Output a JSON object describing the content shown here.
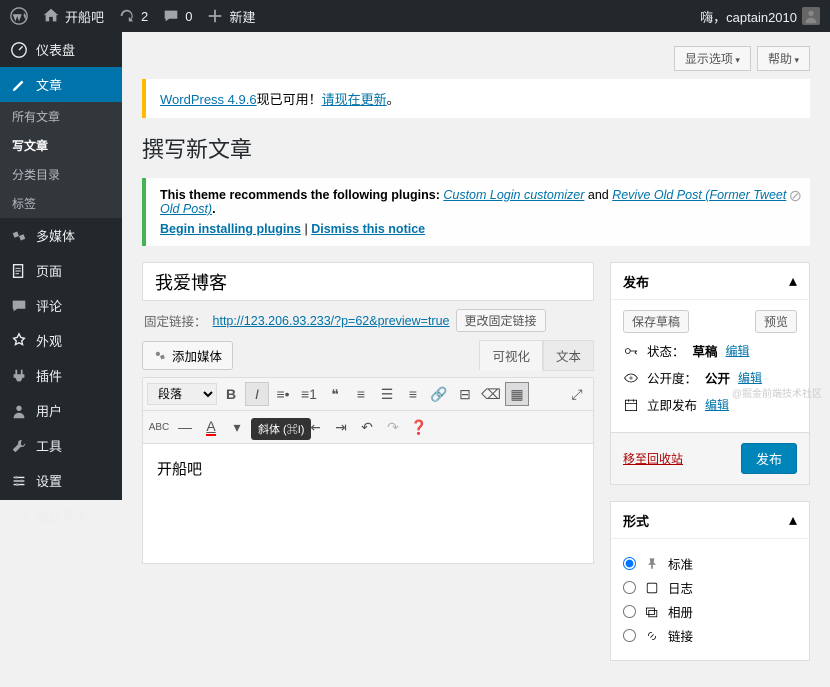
{
  "adminbar": {
    "site_name": "开船吧",
    "updates_count": "2",
    "comments_count": "0",
    "new_label": "新建",
    "greeting": "嗨，captain2010"
  },
  "sidebar": {
    "dashboard": "仪表盘",
    "posts": "文章",
    "media": "多媒体",
    "pages": "页面",
    "comments": "评论",
    "appearance": "外观",
    "plugins": "插件",
    "users": "用户",
    "tools": "工具",
    "settings": "设置",
    "collapse": "收起菜单",
    "submenu": {
      "all": "所有文章",
      "new": "写文章",
      "categories": "分类目录",
      "tags": "标签"
    }
  },
  "screen": {
    "options": "显示选项",
    "help": "帮助"
  },
  "update_notice": {
    "prefix": "WordPress 4.9.6",
    "text": "现已可用！",
    "link": "请现在更新",
    "suffix": "。"
  },
  "page": {
    "title": "撰写新文章"
  },
  "plugin_notice": {
    "text1": "This theme recommends the following plugins: ",
    "link1": "Custom Login customizer",
    "text2": " and ",
    "link2": "Revive Old Post (Former Tweet Old Post)",
    "text3": ".",
    "begin_install": "Begin installing plugins",
    "sep": " | ",
    "dismiss": "Dismiss this notice"
  },
  "editor": {
    "title_value": "我爱博客",
    "permalink_label": "固定链接：",
    "permalink_url": "http://123.206.93.233/?p=62&preview=true",
    "permalink_edit": "更改固定链接",
    "add_media": "添加媒体",
    "tab_visual": "可视化",
    "tab_text": "文本",
    "format_select": "段落",
    "tooltip_italic": "斜体 (⌘I)",
    "body_text": "开船吧"
  },
  "publish": {
    "box_title": "发布",
    "save_draft": "保存草稿",
    "preview": "预览",
    "status_label": "状态：",
    "status_value": "草稿",
    "visibility_label": "公开度：",
    "visibility_value": "公开",
    "schedule_label": "立即发布",
    "edit": "编辑",
    "trash": "移至回收站",
    "publish_btn": "发布"
  },
  "format": {
    "box_title": "形式",
    "standard": "标准",
    "aside": "日志",
    "gallery": "相册",
    "link": "链接"
  },
  "watermark": "@掘金前端技术社区"
}
